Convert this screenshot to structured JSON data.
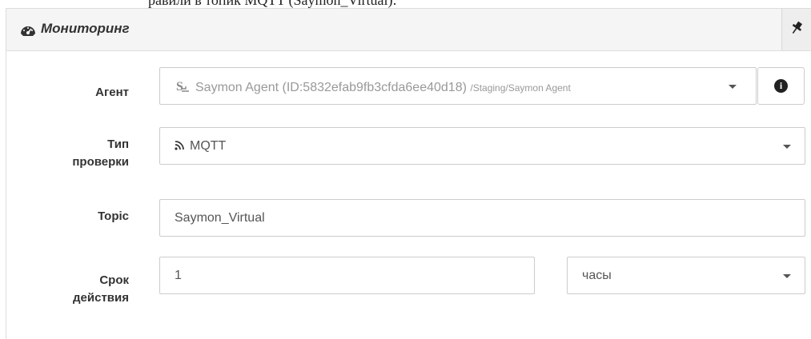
{
  "top_snippet": "равили в топик MQTT (Saymon_Virtual):",
  "panel": {
    "title": "Мониторинг",
    "icon": "dashboard-icon",
    "pin_icon": "pin-icon"
  },
  "form": {
    "agent": {
      "label": "Агент",
      "icon": "saymon-agent-icon",
      "value": "Saymon Agent (ID:5832efab9fb3cfda6ee40d18)",
      "path": "/Staging/Saymon Agent",
      "info_icon": "info-circle-icon"
    },
    "check_type": {
      "label_line1": "Тип",
      "label_line2": "проверки",
      "icon": "rss-icon",
      "value": "MQTT"
    },
    "topic": {
      "label": "Topic",
      "value": "Saymon_Virtual"
    },
    "expiry": {
      "label_line1": "Срок",
      "label_line2": "действия",
      "value": "1",
      "unit": "часы"
    }
  }
}
